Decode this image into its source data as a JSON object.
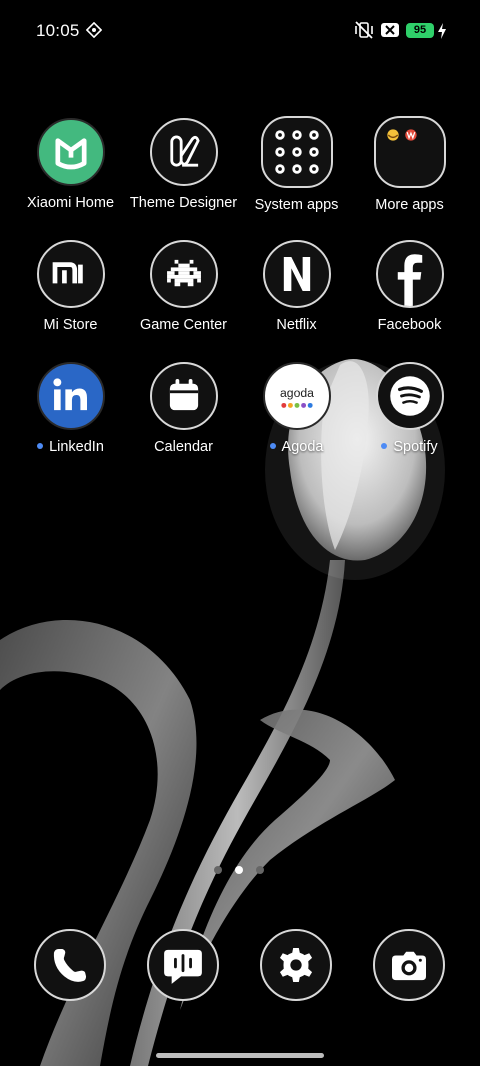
{
  "status_bar": {
    "time": "10:05",
    "battery_level": "95",
    "icons": [
      "nfc-icon",
      "vibrate-mute-icon",
      "no-sim-icon",
      "battery-icon",
      "charging-icon"
    ]
  },
  "apps": [
    {
      "label": "Xiaomi Home",
      "icon": "xiaomi-home-icon",
      "new": false
    },
    {
      "label": "Theme Designer",
      "icon": "theme-designer-icon",
      "new": false
    },
    {
      "label": "System apps",
      "icon": "folder-icon",
      "new": false
    },
    {
      "label": "More apps",
      "icon": "folder-icon",
      "new": false
    },
    {
      "label": "Mi Store",
      "icon": "mi-store-icon",
      "new": false
    },
    {
      "label": "Game Center",
      "icon": "space-invader-icon",
      "new": false
    },
    {
      "label": "Netflix",
      "icon": "netflix-icon",
      "new": false
    },
    {
      "label": "Facebook",
      "icon": "facebook-icon",
      "new": false
    },
    {
      "label": "LinkedIn",
      "icon": "linkedin-icon",
      "new": true
    },
    {
      "label": "Calendar",
      "icon": "calendar-icon",
      "new": false
    },
    {
      "label": "Agoda",
      "icon": "agoda-icon",
      "new": true
    },
    {
      "label": "Spotify",
      "icon": "spotify-icon",
      "new": true
    }
  ],
  "agoda_logo_text": "agoda",
  "pager": {
    "pages": 3,
    "current": 2
  },
  "dock": [
    "phone-icon",
    "messages-icon",
    "settings-icon",
    "camera-icon"
  ],
  "colors": {
    "accent_dot": "#4d8bf5",
    "battery": "#2fd06a",
    "xiaomi_home_green": "#43b97f",
    "linkedin_blue": "#2a67c6"
  }
}
